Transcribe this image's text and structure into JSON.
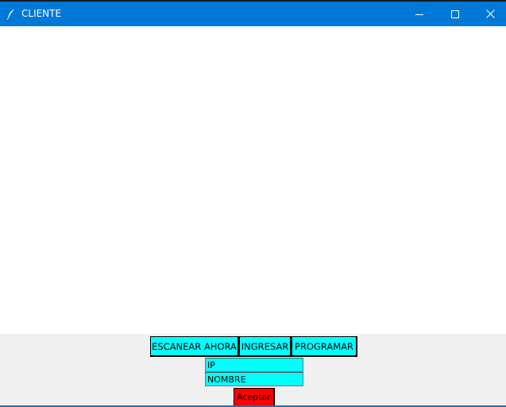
{
  "window": {
    "title": "CLIENTE",
    "titlebar_color": "#0078d7",
    "icon": "feather-icon",
    "controls": {
      "minimize": "minimize-icon",
      "maximize": "maximize-icon",
      "close": "close-icon"
    }
  },
  "toolbar": {
    "scan_label": "ESCANEAR AHORA",
    "ingresar_label": "INGRESAR",
    "programar_label": "PROGRAMAR",
    "button_color": "#00ffff"
  },
  "form": {
    "ip_value": "IP",
    "nombre_value": "NOMBRE",
    "field_color": "#00ffff",
    "accept_label": "Aceptar",
    "accept_color": "#ff0000"
  }
}
